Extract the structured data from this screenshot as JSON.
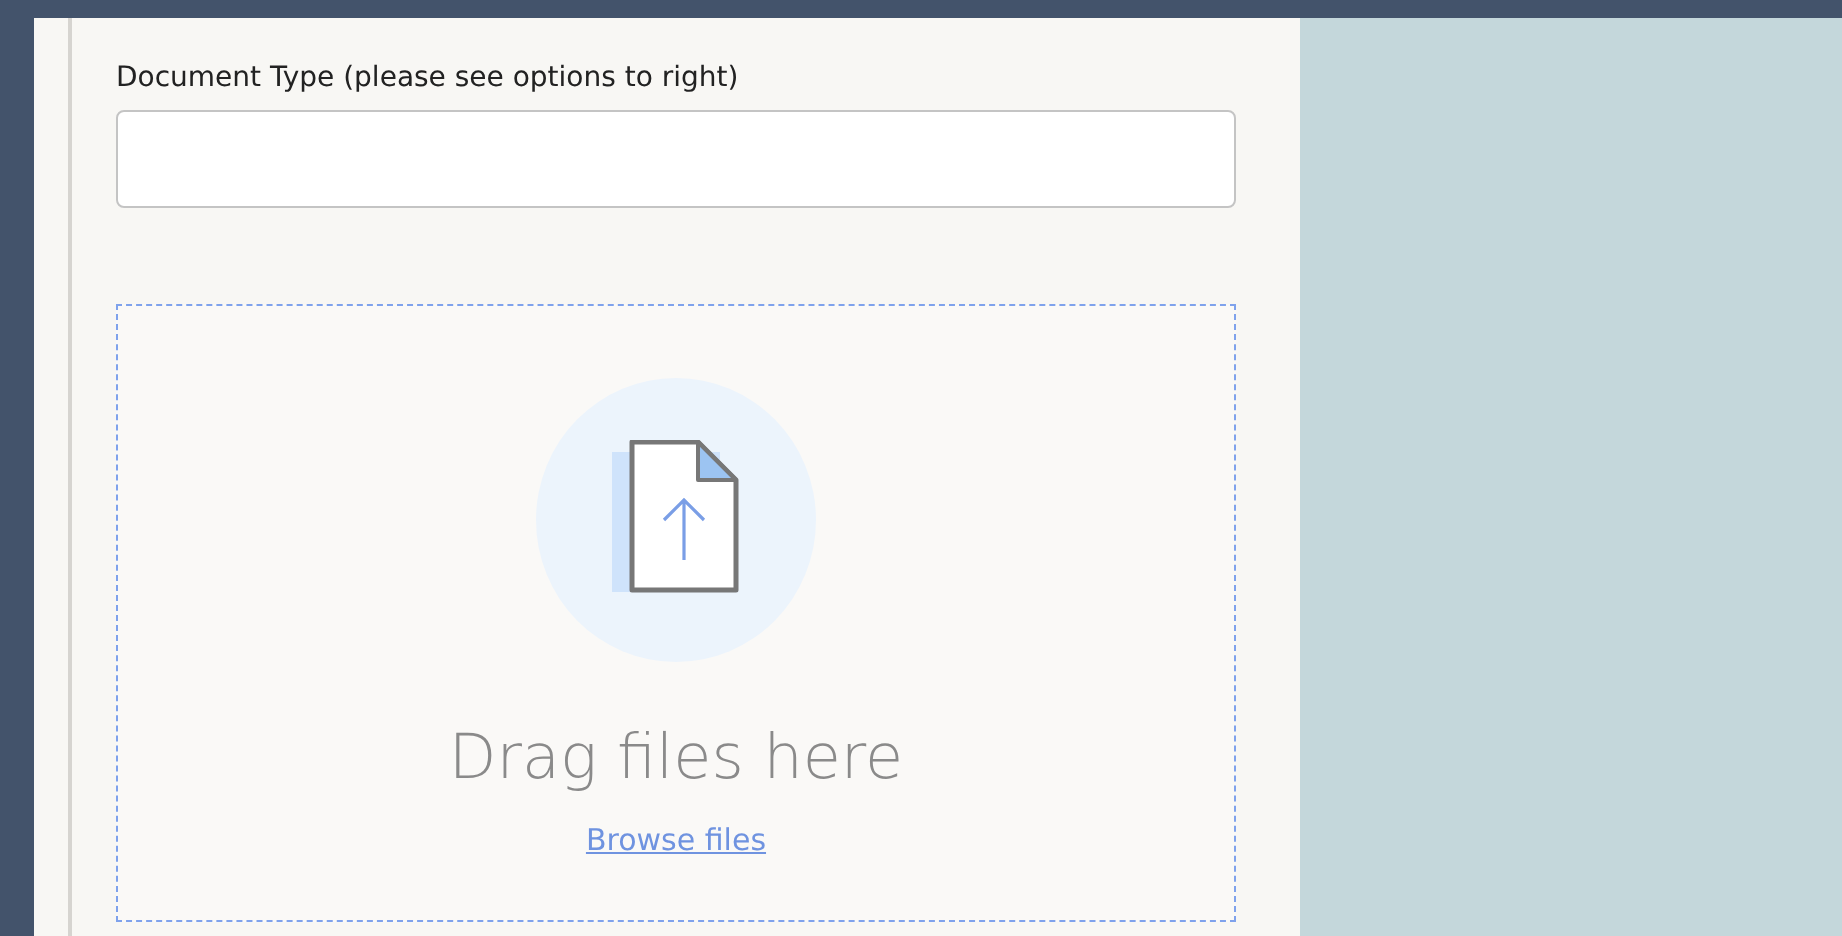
{
  "form": {
    "field": {
      "label": "Document Type (please see options to right)"
    },
    "dropzone": {
      "prompt": "Drag files here",
      "link": "Browse files"
    }
  }
}
